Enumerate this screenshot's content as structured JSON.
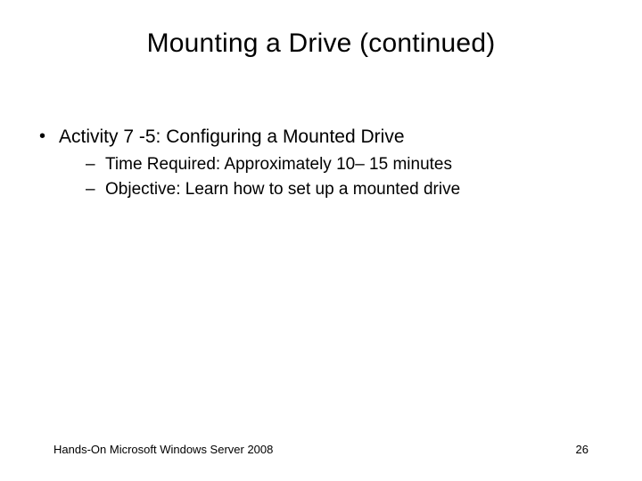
{
  "title": "Mounting a Drive (continued)",
  "bullets": {
    "activity": "Activity 7 -5: Configuring a Mounted Drive",
    "time": "Time Required: Approximately 10– 15 minutes",
    "objective": "Objective: Learn how to set up a mounted drive"
  },
  "footer": {
    "source": "Hands-On Microsoft Windows Server 2008",
    "page": "26"
  }
}
